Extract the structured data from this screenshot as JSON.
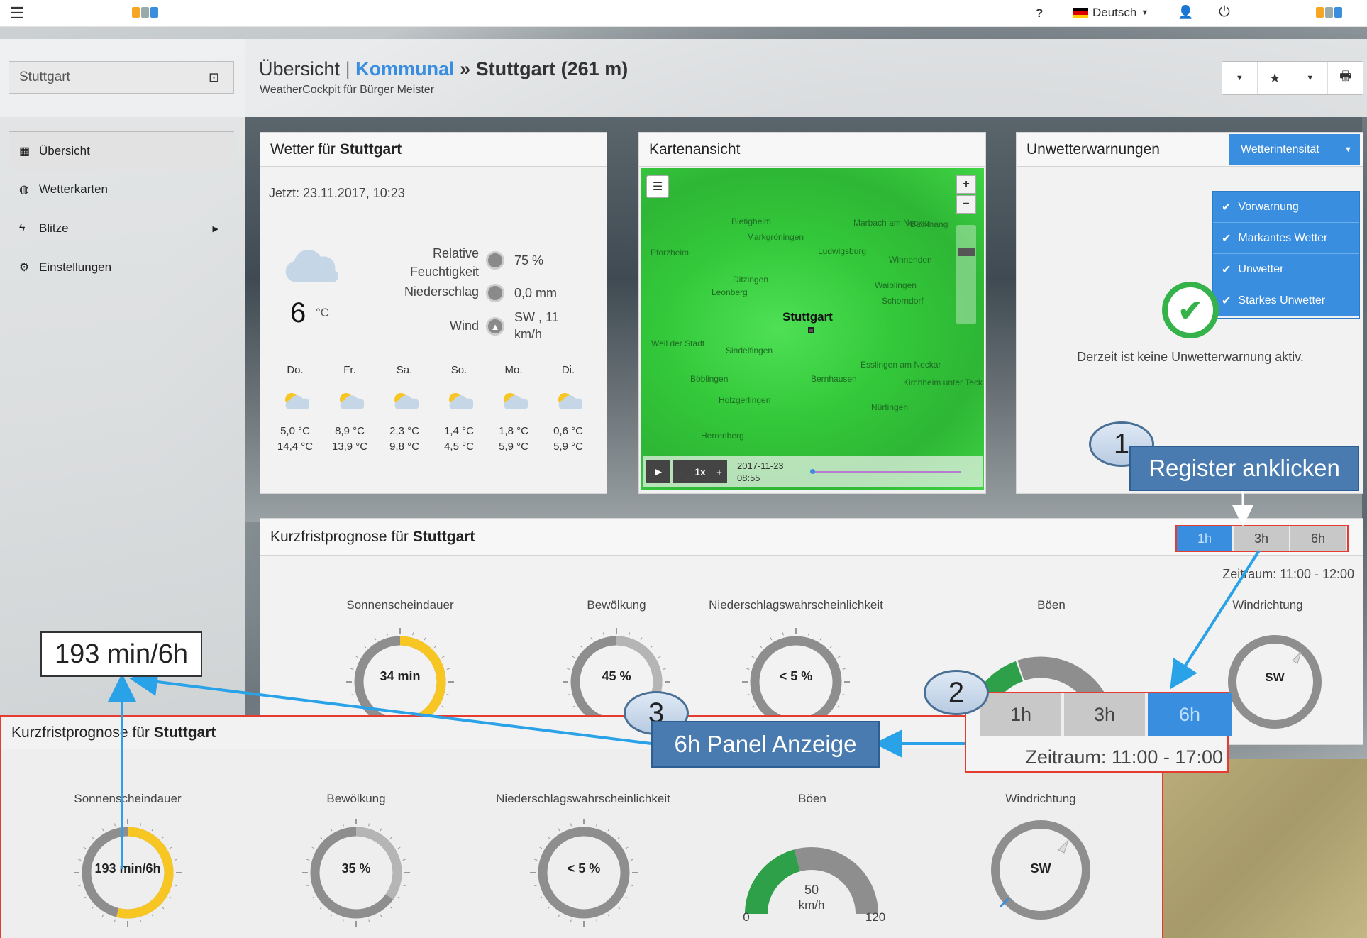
{
  "topbar": {
    "help": "?",
    "language": "Deutsch",
    "user_icon": "user-icon",
    "power_icon": "power-icon",
    "menu_icon": "hamburger-icon"
  },
  "search": {
    "value": "Stuttgart"
  },
  "header": {
    "breadcrumb_root": "Übersicht",
    "breadcrumb_sep": "|",
    "breadcrumb_link": "Kommunal",
    "breadcrumb_arrow": "»",
    "breadcrumb_current": "Stuttgart (261 m)",
    "subtitle": "WeatherCockpit für Bürger Meister"
  },
  "sidebar": {
    "items": [
      {
        "label": "Übersicht",
        "icon": "grid-icon"
      },
      {
        "label": "Wetterkarten",
        "icon": "globe-icon"
      },
      {
        "label": "Blitze",
        "icon": "bolt-icon"
      },
      {
        "label": "Einstellungen",
        "icon": "gears-icon"
      }
    ]
  },
  "weather": {
    "title_prefix": "Wetter für",
    "title_city": "Stuttgart",
    "now": "Jetzt: 23.11.2017, 10:23",
    "temp": "6",
    "temp_unit": "°C",
    "humidity_label_1": "Relative",
    "humidity_label_2": "Feuchtigkeit",
    "humidity": "75 %",
    "precip_label": "Niederschlag",
    "precip": "0,0 mm",
    "wind_label": "Wind",
    "wind_1": "SW , 11",
    "wind_2": "km/h",
    "forecast": [
      {
        "day": "Do.",
        "lo": "5,0 °C",
        "hi": "14,4 °C"
      },
      {
        "day": "Fr.",
        "lo": "8,9 °C",
        "hi": "13,9 °C"
      },
      {
        "day": "Sa.",
        "lo": "2,3 °C",
        "hi": "9,8 °C"
      },
      {
        "day": "So.",
        "lo": "1,4 °C",
        "hi": "4,5 °C"
      },
      {
        "day": "Mo.",
        "lo": "1,8 °C",
        "hi": "5,9 °C"
      },
      {
        "day": "Di.",
        "lo": "0,6 °C",
        "hi": "5,9 °C"
      }
    ]
  },
  "map": {
    "title": "Kartenansicht",
    "zoom_in": "+",
    "zoom_out": "−",
    "speed": "1x",
    "minus": "-",
    "plus": "+",
    "time_date": "2017-11-23",
    "time_clock": "08:55",
    "places": [
      "Pforzheim",
      "Bietigheim",
      "Ludwigsburg",
      "Marbach am Neckar",
      "Backnang",
      "Winnenden",
      "Waiblingen",
      "Leonberg",
      "Ditzingen",
      "Stuttgart",
      "Schorndorf",
      "Böblingen",
      "Esslingen am Neckar",
      "Herrenberg",
      "Nürtingen",
      "Kirchheim unter Teck",
      "Bernhausen",
      "Holzgerlingen",
      "Markgröningen",
      "Sindelfingen",
      "Weil der Stadt"
    ]
  },
  "warnings": {
    "title": "Unwetterwarnungen",
    "dropdown": "Wetterintensität",
    "options": [
      "Vorwarnung",
      "Markantes Wetter",
      "Unwetter",
      "Starkes Unwetter"
    ],
    "none_text": "Derzeit ist keine Unwetterwarnung aktiv."
  },
  "forecast_short": {
    "title_prefix": "Kurzfristprognose für",
    "title_city": "Stuttgart",
    "tabs": [
      "1h",
      "3h",
      "6h"
    ],
    "period": "Zeitraum: 11:00 - 12:00",
    "sun_label": "Sonnenscheindauer",
    "sun": "34 min",
    "sun_fraction": 0.57,
    "cloud_label": "Bewölkung",
    "cloud": "45 %",
    "cloud_fraction": 0.45,
    "rain_label": "Niederschlagswahrscheinlichkeit",
    "rain": "< 5 %",
    "gust_label": "Böen",
    "gust_partial": "40",
    "wind_label": "Windrichtung",
    "wind": "SW"
  },
  "zoom_tabs": {
    "tabs": [
      "1h",
      "3h",
      "6h"
    ],
    "period": "Zeitraum: 11:00 - 17:00"
  },
  "forecast_6h": {
    "title_prefix": "Kurzfristprognose für",
    "title_city": "Stuttgart",
    "sun_label": "Sonnenscheindauer",
    "sun": "193 min/6h",
    "sun_fraction": 0.54,
    "cloud_label": "Bewölkung",
    "cloud": "35 %",
    "cloud_fraction": 0.35,
    "rain_label": "Niederschlagswahrscheinlichkeit",
    "rain": "< 5 %",
    "gust_label": "Böen",
    "gust": "50",
    "gust_unit": "km/h",
    "gust_min": "0",
    "gust_max": "120",
    "gust_value": 50,
    "wind_label": "Windrichtung",
    "wind": "SW"
  },
  "annotations": {
    "step1": "1",
    "step1_text": "Register anklicken",
    "step2": "2",
    "step3": "3",
    "step3_text": "6h Panel Anzeige",
    "zoom_value": "193 min/6h"
  },
  "colors": {
    "accent": "#3a8ee0",
    "sun": "#f7c623",
    "gauge_grey": "#8e8e8e",
    "gust_green": "#2fa04a",
    "check_green": "#35b24a",
    "callout": "#4a7bb0",
    "highlight": "#e53b30",
    "map_green": "#3fd445"
  }
}
